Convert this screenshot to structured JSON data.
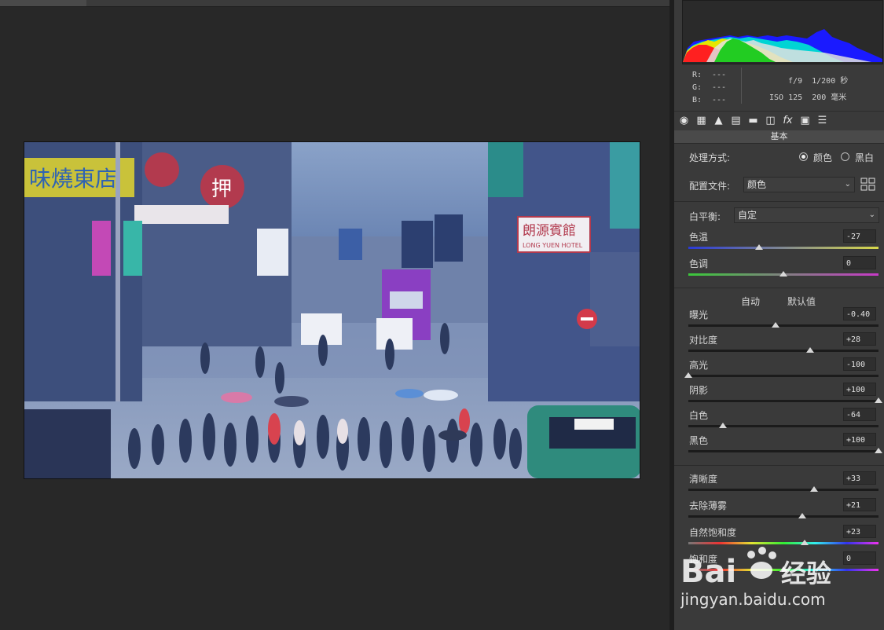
{
  "colors": {
    "panel": "#3a3a3a",
    "canvas": "#282828",
    "accent": "#e0e0e0"
  },
  "readout": {
    "r_label": "R:",
    "g_label": "G:",
    "b_label": "B:",
    "r_val": "---",
    "g_val": "---",
    "b_val": "---",
    "aperture": "f/9",
    "shutter": "1/200 秒",
    "iso": "ISO 125",
    "focal": "200 毫米"
  },
  "tools": [
    "basic-icon",
    "tone-curve-icon",
    "detail-icon",
    "hsl-icon",
    "split-toning-icon",
    "lens-corrections-icon",
    "effects-icon",
    "camera-calibration-icon",
    "presets-icon"
  ],
  "tab_title": "基本",
  "treatment": {
    "label": "处理方式:",
    "color": "颜色",
    "bw": "黑白",
    "selected": "颜色"
  },
  "profile": {
    "label": "配置文件:",
    "value": "颜色"
  },
  "white_balance": {
    "label": "白平衡:",
    "value": "自定"
  },
  "links": {
    "auto": "自动",
    "default": "默认值"
  },
  "sliders": [
    {
      "id": "temp",
      "label": "色温",
      "value": "-27",
      "level": 0.37
    },
    {
      "id": "tint",
      "label": "色调",
      "value": "0",
      "level": 0.5
    },
    {
      "id": "exposure",
      "label": "曝光",
      "value": "-0.40",
      "level": 0.46
    },
    {
      "id": "contrast",
      "label": "对比度",
      "value": "+28",
      "level": 0.64
    },
    {
      "id": "highlights",
      "label": "高光",
      "value": "-100",
      "level": 0.0
    },
    {
      "id": "shadows",
      "label": "阴影",
      "value": "+100",
      "level": 1.0
    },
    {
      "id": "whites",
      "label": "白色",
      "value": "-64",
      "level": 0.18
    },
    {
      "id": "blacks",
      "label": "黑色",
      "value": "+100",
      "level": 1.0
    },
    {
      "id": "clarity",
      "label": "清晰度",
      "value": "+33",
      "level": 0.66
    },
    {
      "id": "dehaze",
      "label": "去除薄雾",
      "value": "+21",
      "level": 0.6
    },
    {
      "id": "vibrance",
      "label": "自然饱和度",
      "value": "+23",
      "level": 0.61
    },
    {
      "id": "saturation",
      "label": "饱和度",
      "value": "0",
      "level": 0.5
    }
  ],
  "photo_signs": {
    "s1": "味燒東店",
    "s2": "押",
    "s3": "朗源賓館",
    "s4": "LONG YUEN HOTEL"
  },
  "watermark": {
    "brand": "Bai",
    "brand2": "经验",
    "url": "jingyan.baidu.com"
  }
}
